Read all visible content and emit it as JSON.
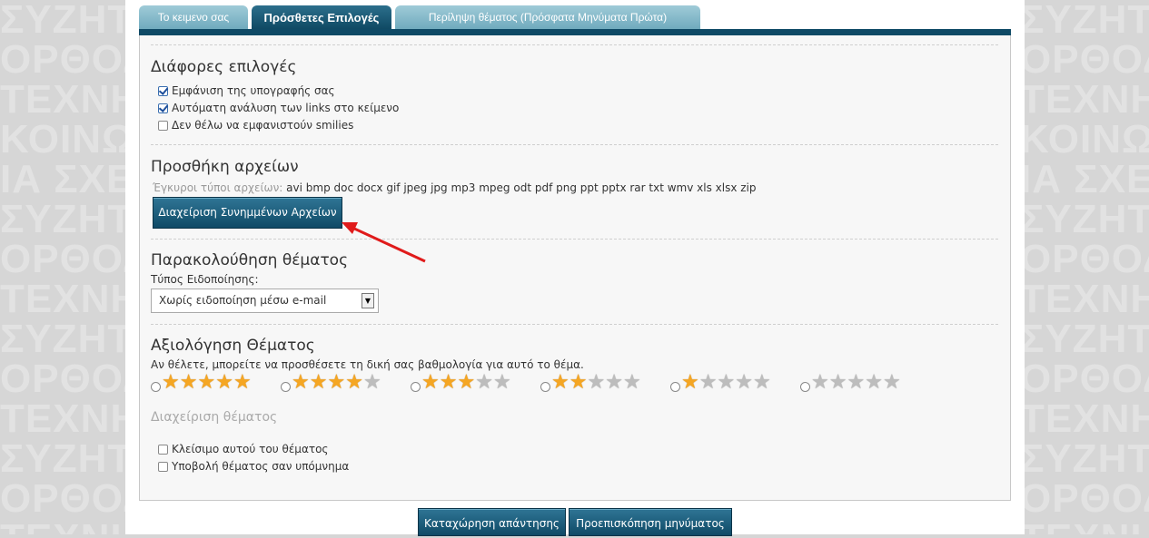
{
  "background_words": [
    "ΣΥΖΗΤΗ",
    "ΟΡΘΟΔΛ",
    "ΤΕΧΝΗ",
    "ΚΟΙΝΩΝ",
    "ΙΑ ΣΧΕ",
    "ΣΥΖΗΤΗ",
    "ΟΡΘΟΔΛ",
    "ΤΕΧΝΗ",
    "ΣΥΖΗΤΗ",
    "ΟΡΘΟΔΛ",
    "ΤΕΧΝΗ",
    "ΣΥΖΗΤΗ",
    "ΟΡΘΟΔΛ",
    "ΤΕΧΝΗ"
  ],
  "tabs": {
    "text": "Το κειμενο σας",
    "options": "Πρόσθετες Επιλογές",
    "summary": "Περίληψη θέματος (Πρόσφατα Μηνύματα Πρώτα)"
  },
  "misc": {
    "title": "Διάφορες επιλογές",
    "opt1": "Εμφάνιση της υπογραφής σας",
    "opt2": "Αυτόματη ανάλυση των links στο κείμενο",
    "opt3": "Δεν θέλω να εμφανιστούν smilies"
  },
  "attachments": {
    "title": "Προσθήκη αρχείων",
    "types_label": "Έγκυροι τύποι αρχείων:",
    "types": "avi bmp doc docx gif jpeg jpg mp3 mpeg odt pdf png ppt pptx rar txt wmv xls xlsx zip",
    "manage_button": "Διαχείριση Συνημμένων Αρχείων"
  },
  "subscription": {
    "title": "Παρακολούθηση θέματος",
    "label": "Τύπος Ειδοποίησης:",
    "selected": "Χωρίς ειδοποίηση μέσω e-mail"
  },
  "rating": {
    "title": "Αξιολόγηση Θέματος",
    "desc": "Αν θέλετε, μπορείτε να προσθέσετε τη δική σας βαθμολογία για αυτό το θέμα.",
    "levels": [
      5,
      4,
      3,
      2,
      1,
      0
    ]
  },
  "moderation": {
    "title": "Διαχείριση θέματος",
    "opt1": "Κλείσιμο αυτού του θέματος",
    "opt2": "Υποβολή θέματος σαν υπόμνημα"
  },
  "buttons": {
    "submit": "Καταχώρηση απάντησης",
    "preview": "Προεπισκόπηση μηνύματος"
  },
  "colors": {
    "accent": "#0f4a66",
    "annotation_arrow": "#e01b1b"
  }
}
